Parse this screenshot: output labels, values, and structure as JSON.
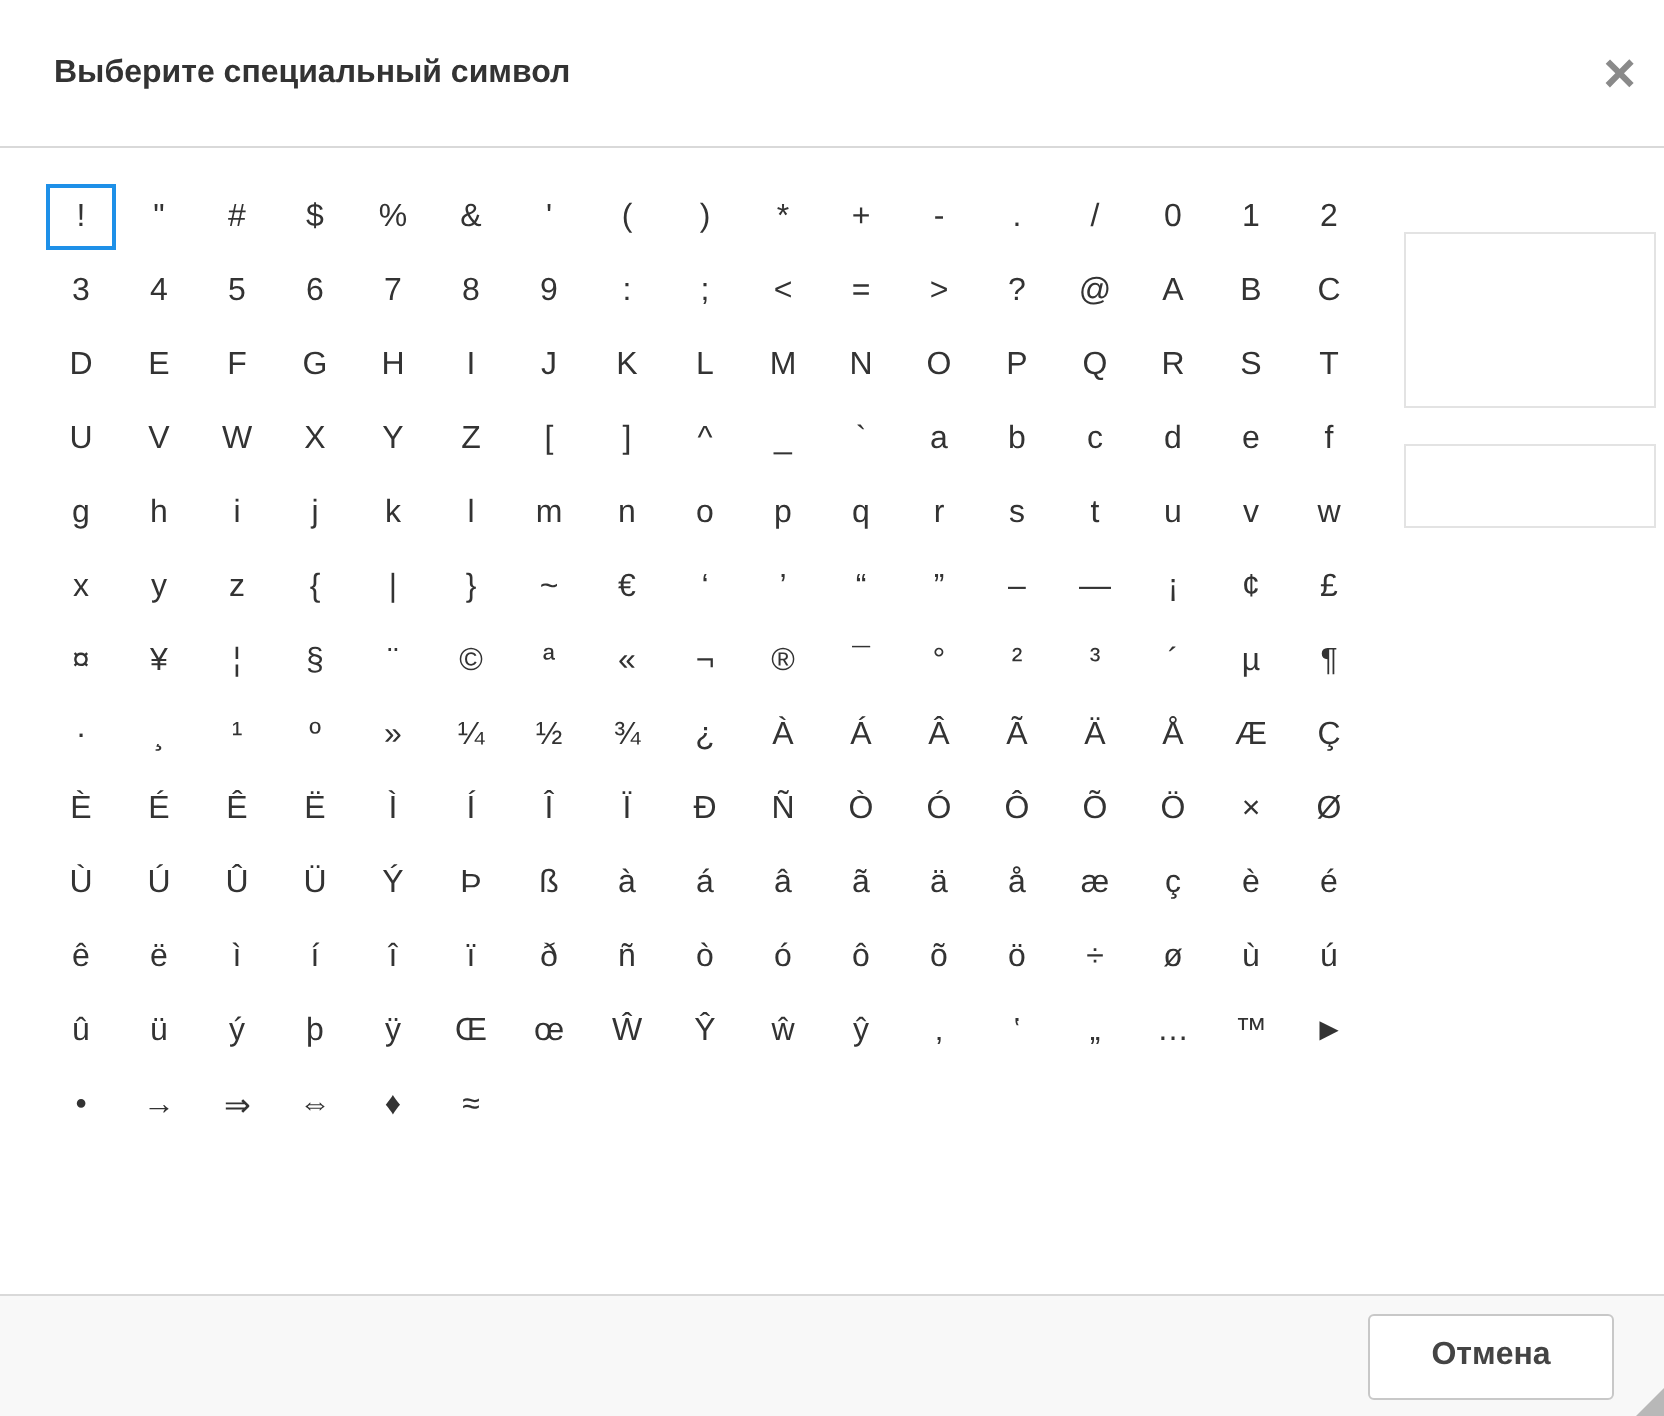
{
  "dialog": {
    "title": "Выберите специальный символ",
    "close": "×"
  },
  "rows": [
    [
      {
        "char": "!",
        "selected": true
      },
      {
        "char": "\"",
        "selected": false
      },
      {
        "char": "#",
        "selected": false
      },
      {
        "char": "$",
        "selected": false
      },
      {
        "char": "%",
        "selected": false
      },
      {
        "char": "&",
        "selected": false
      },
      {
        "char": "'",
        "selected": false
      },
      {
        "char": "(",
        "selected": false
      },
      {
        "char": ")",
        "selected": false
      },
      {
        "char": "*",
        "selected": false
      },
      {
        "char": "+",
        "selected": false
      },
      {
        "char": "-",
        "selected": false
      },
      {
        "char": ".",
        "selected": false
      },
      {
        "char": "/",
        "selected": false
      },
      {
        "char": "0",
        "selected": false
      },
      {
        "char": "1",
        "selected": false
      },
      {
        "char": "2",
        "selected": false
      }
    ],
    [
      {
        "char": "3",
        "selected": false
      },
      {
        "char": "4",
        "selected": false
      },
      {
        "char": "5",
        "selected": false
      },
      {
        "char": "6",
        "selected": false
      },
      {
        "char": "7",
        "selected": false
      },
      {
        "char": "8",
        "selected": false
      },
      {
        "char": "9",
        "selected": false
      },
      {
        "char": ":",
        "selected": false
      },
      {
        "char": ";",
        "selected": false
      },
      {
        "char": "<",
        "selected": false
      },
      {
        "char": "=",
        "selected": false
      },
      {
        "char": ">",
        "selected": false
      },
      {
        "char": "?",
        "selected": false
      },
      {
        "char": "@",
        "selected": false
      },
      {
        "char": "A",
        "selected": false
      },
      {
        "char": "B",
        "selected": false
      },
      {
        "char": "C",
        "selected": false
      }
    ],
    [
      {
        "char": "D",
        "selected": false
      },
      {
        "char": "E",
        "selected": false
      },
      {
        "char": "F",
        "selected": false
      },
      {
        "char": "G",
        "selected": false
      },
      {
        "char": "H",
        "selected": false
      },
      {
        "char": "I",
        "selected": false
      },
      {
        "char": "J",
        "selected": false
      },
      {
        "char": "K",
        "selected": false
      },
      {
        "char": "L",
        "selected": false
      },
      {
        "char": "M",
        "selected": false
      },
      {
        "char": "N",
        "selected": false
      },
      {
        "char": "O",
        "selected": false
      },
      {
        "char": "P",
        "selected": false
      },
      {
        "char": "Q",
        "selected": false
      },
      {
        "char": "R",
        "selected": false
      },
      {
        "char": "S",
        "selected": false
      },
      {
        "char": "T",
        "selected": false
      }
    ],
    [
      {
        "char": "U",
        "selected": false
      },
      {
        "char": "V",
        "selected": false
      },
      {
        "char": "W",
        "selected": false
      },
      {
        "char": "X",
        "selected": false
      },
      {
        "char": "Y",
        "selected": false
      },
      {
        "char": "Z",
        "selected": false
      },
      {
        "char": "[",
        "selected": false
      },
      {
        "char": "]",
        "selected": false
      },
      {
        "char": "^",
        "selected": false
      },
      {
        "char": "_",
        "selected": false
      },
      {
        "char": "`",
        "selected": false
      },
      {
        "char": "a",
        "selected": false
      },
      {
        "char": "b",
        "selected": false
      },
      {
        "char": "c",
        "selected": false
      },
      {
        "char": "d",
        "selected": false
      },
      {
        "char": "e",
        "selected": false
      },
      {
        "char": "f",
        "selected": false
      }
    ],
    [
      {
        "char": "g",
        "selected": false
      },
      {
        "char": "h",
        "selected": false
      },
      {
        "char": "i",
        "selected": false
      },
      {
        "char": "j",
        "selected": false
      },
      {
        "char": "k",
        "selected": false
      },
      {
        "char": "l",
        "selected": false
      },
      {
        "char": "m",
        "selected": false
      },
      {
        "char": "n",
        "selected": false
      },
      {
        "char": "o",
        "selected": false
      },
      {
        "char": "p",
        "selected": false
      },
      {
        "char": "q",
        "selected": false
      },
      {
        "char": "r",
        "selected": false
      },
      {
        "char": "s",
        "selected": false
      },
      {
        "char": "t",
        "selected": false
      },
      {
        "char": "u",
        "selected": false
      },
      {
        "char": "v",
        "selected": false
      },
      {
        "char": "w",
        "selected": false
      }
    ],
    [
      {
        "char": "x",
        "selected": false
      },
      {
        "char": "y",
        "selected": false
      },
      {
        "char": "z",
        "selected": false
      },
      {
        "char": "{",
        "selected": false
      },
      {
        "char": "|",
        "selected": false
      },
      {
        "char": "}",
        "selected": false
      },
      {
        "char": "~",
        "selected": false
      },
      {
        "char": "€",
        "selected": false
      },
      {
        "char": "‘",
        "selected": false
      },
      {
        "char": "’",
        "selected": false
      },
      {
        "char": "“",
        "selected": false
      },
      {
        "char": "”",
        "selected": false
      },
      {
        "char": "–",
        "selected": false
      },
      {
        "char": "—",
        "selected": false
      },
      {
        "char": "¡",
        "selected": false
      },
      {
        "char": "¢",
        "selected": false
      },
      {
        "char": "£",
        "selected": false
      }
    ],
    [
      {
        "char": "¤",
        "selected": false
      },
      {
        "char": "¥",
        "selected": false
      },
      {
        "char": "¦",
        "selected": false
      },
      {
        "char": "§",
        "selected": false
      },
      {
        "char": "¨",
        "selected": false
      },
      {
        "char": "©",
        "selected": false
      },
      {
        "char": "ª",
        "selected": false
      },
      {
        "char": "«",
        "selected": false
      },
      {
        "char": "¬",
        "selected": false
      },
      {
        "char": "®",
        "selected": false
      },
      {
        "char": "¯",
        "selected": false
      },
      {
        "char": "°",
        "selected": false
      },
      {
        "char": "²",
        "selected": false
      },
      {
        "char": "³",
        "selected": false
      },
      {
        "char": "´",
        "selected": false
      },
      {
        "char": "µ",
        "selected": false
      },
      {
        "char": "¶",
        "selected": false
      }
    ],
    [
      {
        "char": "·",
        "selected": false
      },
      {
        "char": "¸",
        "selected": false
      },
      {
        "char": "¹",
        "selected": false
      },
      {
        "char": "º",
        "selected": false
      },
      {
        "char": "»",
        "selected": false
      },
      {
        "char": "¼",
        "selected": false
      },
      {
        "char": "½",
        "selected": false
      },
      {
        "char": "¾",
        "selected": false
      },
      {
        "char": "¿",
        "selected": false
      },
      {
        "char": "À",
        "selected": false
      },
      {
        "char": "Á",
        "selected": false
      },
      {
        "char": "Â",
        "selected": false
      },
      {
        "char": "Ã",
        "selected": false
      },
      {
        "char": "Ä",
        "selected": false
      },
      {
        "char": "Å",
        "selected": false
      },
      {
        "char": "Æ",
        "selected": false
      },
      {
        "char": "Ç",
        "selected": false
      }
    ],
    [
      {
        "char": "È",
        "selected": false
      },
      {
        "char": "É",
        "selected": false
      },
      {
        "char": "Ê",
        "selected": false
      },
      {
        "char": "Ë",
        "selected": false
      },
      {
        "char": "Ì",
        "selected": false
      },
      {
        "char": "Í",
        "selected": false
      },
      {
        "char": "Î",
        "selected": false
      },
      {
        "char": "Ï",
        "selected": false
      },
      {
        "char": "Ð",
        "selected": false
      },
      {
        "char": "Ñ",
        "selected": false
      },
      {
        "char": "Ò",
        "selected": false
      },
      {
        "char": "Ó",
        "selected": false
      },
      {
        "char": "Ô",
        "selected": false
      },
      {
        "char": "Õ",
        "selected": false
      },
      {
        "char": "Ö",
        "selected": false
      },
      {
        "char": "×",
        "selected": false
      },
      {
        "char": "Ø",
        "selected": false
      }
    ],
    [
      {
        "char": "Ù",
        "selected": false
      },
      {
        "char": "Ú",
        "selected": false
      },
      {
        "char": "Û",
        "selected": false
      },
      {
        "char": "Ü",
        "selected": false
      },
      {
        "char": "Ý",
        "selected": false
      },
      {
        "char": "Þ",
        "selected": false
      },
      {
        "char": "ß",
        "selected": false
      },
      {
        "char": "à",
        "selected": false
      },
      {
        "char": "á",
        "selected": false
      },
      {
        "char": "â",
        "selected": false
      },
      {
        "char": "ã",
        "selected": false
      },
      {
        "char": "ä",
        "selected": false
      },
      {
        "char": "å",
        "selected": false
      },
      {
        "char": "æ",
        "selected": false
      },
      {
        "char": "ç",
        "selected": false
      },
      {
        "char": "è",
        "selected": false
      },
      {
        "char": "é",
        "selected": false
      }
    ],
    [
      {
        "char": "ê",
        "selected": false
      },
      {
        "char": "ë",
        "selected": false
      },
      {
        "char": "ì",
        "selected": false
      },
      {
        "char": "í",
        "selected": false
      },
      {
        "char": "î",
        "selected": false
      },
      {
        "char": "ï",
        "selected": false
      },
      {
        "char": "ð",
        "selected": false
      },
      {
        "char": "ñ",
        "selected": false
      },
      {
        "char": "ò",
        "selected": false
      },
      {
        "char": "ó",
        "selected": false
      },
      {
        "char": "ô",
        "selected": false
      },
      {
        "char": "õ",
        "selected": false
      },
      {
        "char": "ö",
        "selected": false
      },
      {
        "char": "÷",
        "selected": false
      },
      {
        "char": "ø",
        "selected": false
      },
      {
        "char": "ù",
        "selected": false
      },
      {
        "char": "ú",
        "selected": false
      }
    ],
    [
      {
        "char": "û",
        "selected": false
      },
      {
        "char": "ü",
        "selected": false
      },
      {
        "char": "ý",
        "selected": false
      },
      {
        "char": "þ",
        "selected": false
      },
      {
        "char": "ÿ",
        "selected": false
      },
      {
        "char": "Œ",
        "selected": false
      },
      {
        "char": "œ",
        "selected": false
      },
      {
        "char": "Ŵ",
        "selected": false
      },
      {
        "char": "Ŷ",
        "selected": false
      },
      {
        "char": "ŵ",
        "selected": false
      },
      {
        "char": "ŷ",
        "selected": false
      },
      {
        "char": "‚",
        "selected": false
      },
      {
        "char": "‛",
        "selected": false
      },
      {
        "char": "„",
        "selected": false
      },
      {
        "char": "…",
        "selected": false
      },
      {
        "char": "™",
        "selected": false
      },
      {
        "char": "►",
        "selected": false
      }
    ],
    [
      {
        "char": "•",
        "selected": false
      },
      {
        "char": "→",
        "selected": false
      },
      {
        "char": "⇒",
        "selected": false
      },
      {
        "char": "⇔",
        "selected": false
      },
      {
        "char": "♦",
        "selected": false
      },
      {
        "char": "≈",
        "selected": false
      }
    ]
  ],
  "buttons": [
    {
      "label": "Отмена"
    }
  ]
}
